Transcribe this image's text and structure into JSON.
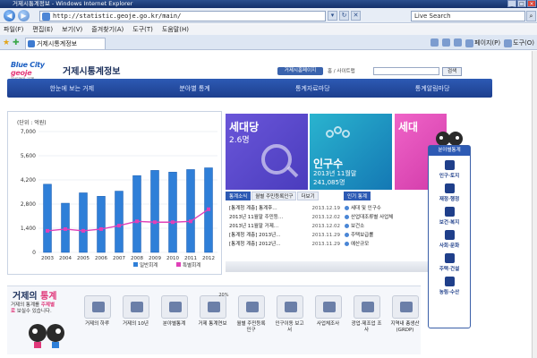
{
  "window": {
    "title": "거제시통계정보 - Windows Internet Explorer",
    "buttons": [
      "_",
      "□",
      "×"
    ]
  },
  "addressbar": {
    "url": "http://statistic.geoje.go.kr/main/",
    "search_placeholder": "Live Search"
  },
  "menubar": {
    "items": [
      "파일(F)",
      "편집(E)",
      "보기(V)",
      "즐겨찾기(A)",
      "도구(T)",
      "도움말(H)"
    ]
  },
  "tabbar": {
    "tab_title": "거제시통계정보",
    "commands": [
      "페이지(P)",
      "도구(O)"
    ]
  },
  "header": {
    "logo_text": "Blue City",
    "logo_badge": "geoje",
    "logo_sub": "블루라인 거제",
    "title": "거제시통계정보",
    "badge": "거제시홈페이지",
    "links": "홈 / 사이트맵",
    "search_button": "검색"
  },
  "gnb": {
    "items": [
      "한눈에 보는 거제",
      "분야별 통계",
      "통계자료마당",
      "통계알림마당"
    ]
  },
  "chart_data": {
    "type": "bar",
    "ylabel": "(단위 : 억원)",
    "categories": [
      "2003",
      "2004",
      "2005",
      "2006",
      "2007",
      "2008",
      "2009",
      "2010",
      "2011",
      "2012"
    ],
    "series": [
      {
        "name": "일반회계",
        "kind": "bar",
        "color": "#2f7fd8",
        "values": [
          3950,
          2850,
          3450,
          3250,
          3550,
          4450,
          4750,
          4650,
          4800,
          4900
        ]
      },
      {
        "name": "특별회계",
        "kind": "line",
        "color": "#e040b8",
        "values": [
          1250,
          1350,
          1250,
          1350,
          1550,
          1800,
          1750,
          1750,
          1800,
          2500
        ]
      }
    ],
    "yticks": [
      0,
      1400,
      2800,
      4200,
      5600,
      7000
    ],
    "ylim": [
      0,
      7000
    ],
    "grid": true,
    "legend": "bottom-right"
  },
  "tiles": [
    {
      "title": "세대당",
      "sub": "2.6명"
    },
    {
      "title": "인구수",
      "sub": "2013년 11월말",
      "extra": "241,085명"
    },
    {
      "title": "세대"
    }
  ],
  "news": {
    "tabs": [
      "통계소식",
      "월별 주민등록인구",
      "더보기"
    ],
    "items": [
      {
        "text": "[통계청 계층] 통계후…",
        "date": "2013.12.19"
      },
      {
        "text": "2013년 11월말 주민등…",
        "date": "2013.12.02"
      },
      {
        "text": "2013년 11월말 거제…",
        "date": "2013.12.02"
      },
      {
        "text": "[통계청 계층] 2013년…",
        "date": "2013.11.29"
      },
      {
        "text": "[통계청 계층] 2012년…",
        "date": "2013.11.29"
      }
    ]
  },
  "qa": {
    "tab": "인기 통계",
    "items": [
      "세대 및 인구수",
      "산업대조류별 사업체",
      "보건소",
      "주택보급률",
      "예산규모"
    ]
  },
  "quick": {
    "title": "분야별통계",
    "items": [
      "인구·토지",
      "재정·행정",
      "보건·복지",
      "사회·문화",
      "주택·건설",
      "농림·수산"
    ]
  },
  "stats": {
    "title_a": "거제의",
    "title_b": "통계",
    "desc_a": "거제의 통계를",
    "desc_em": "주제별로",
    "desc_b": "보실수 있습니다.",
    "buttons": [
      "거제의 하루",
      "거제의 10년",
      "분야별통계",
      "거제 통계연보",
      "월별 주민등록 인구",
      "인구이동 보고서",
      "사업체조사",
      "광업·제조업 조사",
      "지역내 총생산 (GRDP)"
    ],
    "badge20": "20%"
  },
  "colors": {
    "accent": "#2d5ab4",
    "pink": "#e0387a"
  }
}
